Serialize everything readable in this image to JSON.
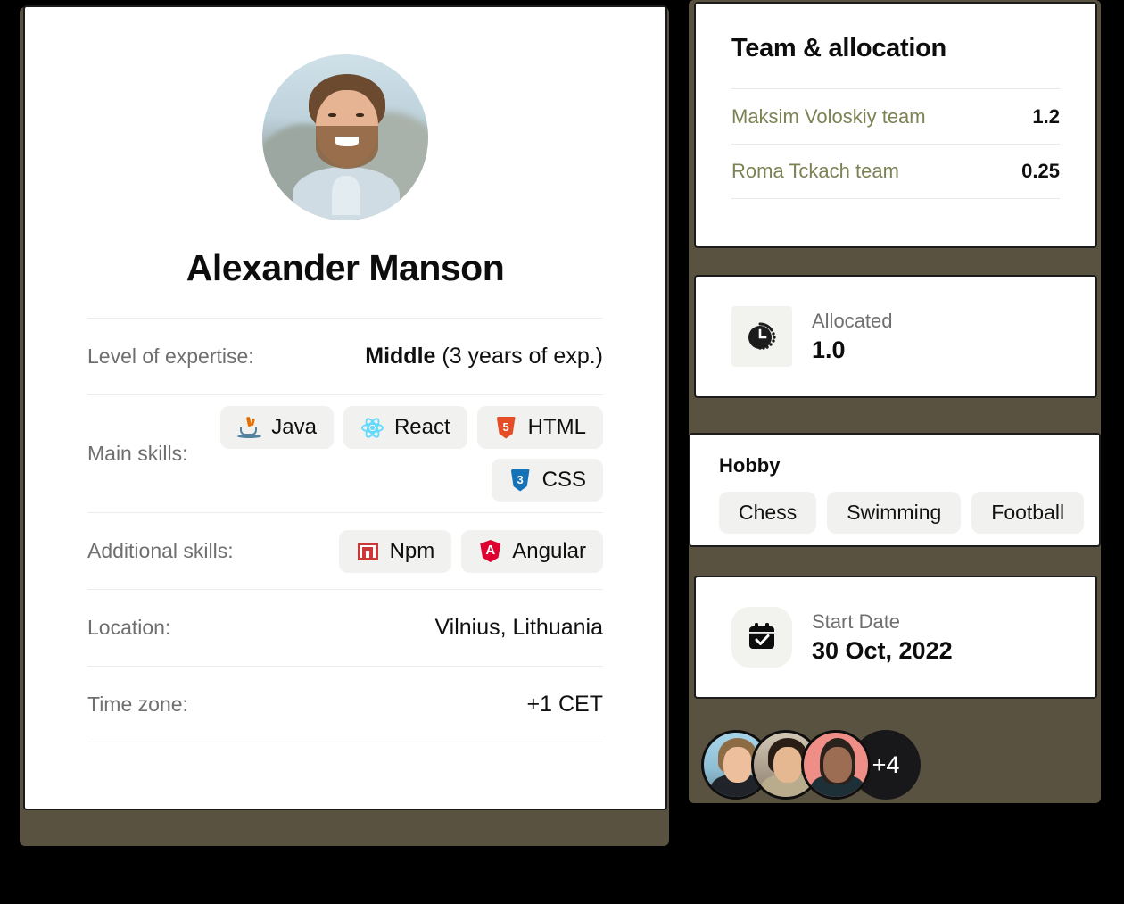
{
  "profile": {
    "avatar_alt": "profile-photo",
    "name": "Alexander Manson",
    "rows": [
      {
        "label": "Level of expertise:",
        "value_strong": "Middle",
        "value_rest": " (3 years of exp.)"
      },
      {
        "label": "Main skills:"
      },
      {
        "label": "Additional skills:"
      },
      {
        "label": "Location:",
        "value": "Vilnius, Lithuania"
      },
      {
        "label": "Time zone:",
        "value": "+1 CET"
      }
    ],
    "main_skills": [
      {
        "name": "Java",
        "icon": "java-icon"
      },
      {
        "name": "React",
        "icon": "react-icon"
      },
      {
        "name": "HTML",
        "icon": "html5-icon"
      },
      {
        "name": "CSS",
        "icon": "css3-icon"
      }
    ],
    "additional_skills": [
      {
        "name": "Npm",
        "icon": "npm-icon"
      },
      {
        "name": "Angular",
        "icon": "angular-icon"
      }
    ]
  },
  "team": {
    "title": "Team & allocation",
    "rows": [
      {
        "name": "Maksim Voloskiy team",
        "allocation": "1.2"
      },
      {
        "name": "Roma Tckach team",
        "allocation": "0.25"
      }
    ],
    "link_color": "#7d8254"
  },
  "allocated": {
    "icon": "clock-icon",
    "label": "Allocated",
    "value": "1.0"
  },
  "hobby": {
    "title": "Hobby",
    "items": [
      "Chess",
      "Swimming",
      "Football"
    ]
  },
  "start_date": {
    "icon": "calendar-check-icon",
    "label": "Start Date",
    "value": "30 Oct, 2022"
  },
  "avatars": {
    "members": [
      "member-avatar-1",
      "member-avatar-2",
      "member-avatar-3"
    ],
    "more_label": "+4"
  },
  "icon_glyphs": {
    "html5": "5",
    "css3": "3",
    "angular": "A"
  },
  "colors": {
    "backdrop": "#5a5240",
    "card": "#ffffff",
    "chip": "#f1f1ef",
    "text": "#0d0d0d",
    "muted": "#6f6f6f",
    "link": "#7d8254"
  }
}
